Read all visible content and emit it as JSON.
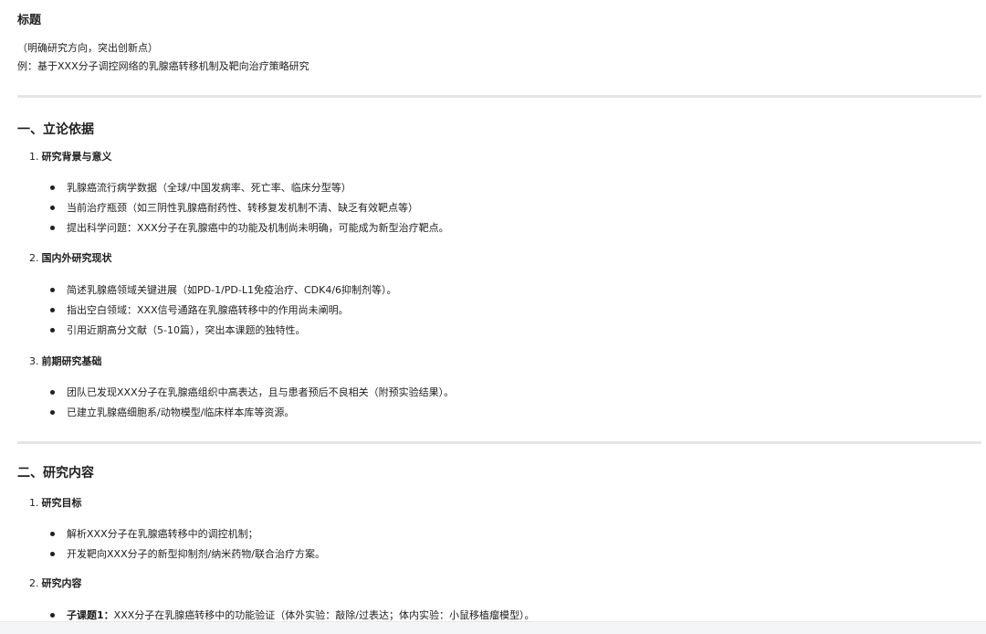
{
  "title": "标题",
  "subtitle_lines": [
    "（明确研究方向，突出创新点）",
    "例：基于XXX分子调控网络的乳腺癌转移机制及靶向治疗策略研究"
  ],
  "section1": {
    "heading": "一、立论依据",
    "sub1": {
      "num": "1.",
      "title": "研究背景与意义",
      "bullets": [
        "乳腺癌流行病学数据（全球/中国发病率、死亡率、临床分型等）",
        "当前治疗瓶颈（如三阴性乳腺癌耐药性、转移复发机制不清、缺乏有效靶点等）",
        "提出科学问题：XXX分子在乳腺癌中的功能及机制尚未明确，可能成为新型治疗靶点。"
      ]
    },
    "sub2": {
      "num": "2.",
      "title": "国内外研究现状",
      "bullets": [
        "简述乳腺癌领域关键进展（如PD-1/PD-L1免疫治疗、CDK4/6抑制剂等）。",
        "指出空白领域：XXX信号通路在乳腺癌转移中的作用尚未阐明。",
        "引用近期高分文献（5-10篇），突出本课题的独特性。"
      ]
    },
    "sub3": {
      "num": "3.",
      "title": "前期研究基础",
      "bullets": [
        "团队已发现XXX分子在乳腺癌组织中高表达，且与患者预后不良相关（附预实验结果）。",
        "已建立乳腺癌细胞系/动物模型/临床样本库等资源。"
      ]
    }
  },
  "section2": {
    "heading": "二、研究内容",
    "sub1": {
      "num": "1.",
      "title": "研究目标",
      "bullets": [
        "解析XXX分子在乳腺癌转移中的调控机制；",
        "开发靶向XXX分子的新型抑制剂/纳米药物/联合治疗方案。"
      ]
    },
    "sub2": {
      "num": "2.",
      "title": "研究内容",
      "bullets": [
        {
          "label": "子课题1：",
          "text": "XXX分子在乳腺癌转移中的功能验证（体外实验：敲除/过表达；体内实验：小鼠移植瘤模型）。"
        }
      ]
    }
  }
}
